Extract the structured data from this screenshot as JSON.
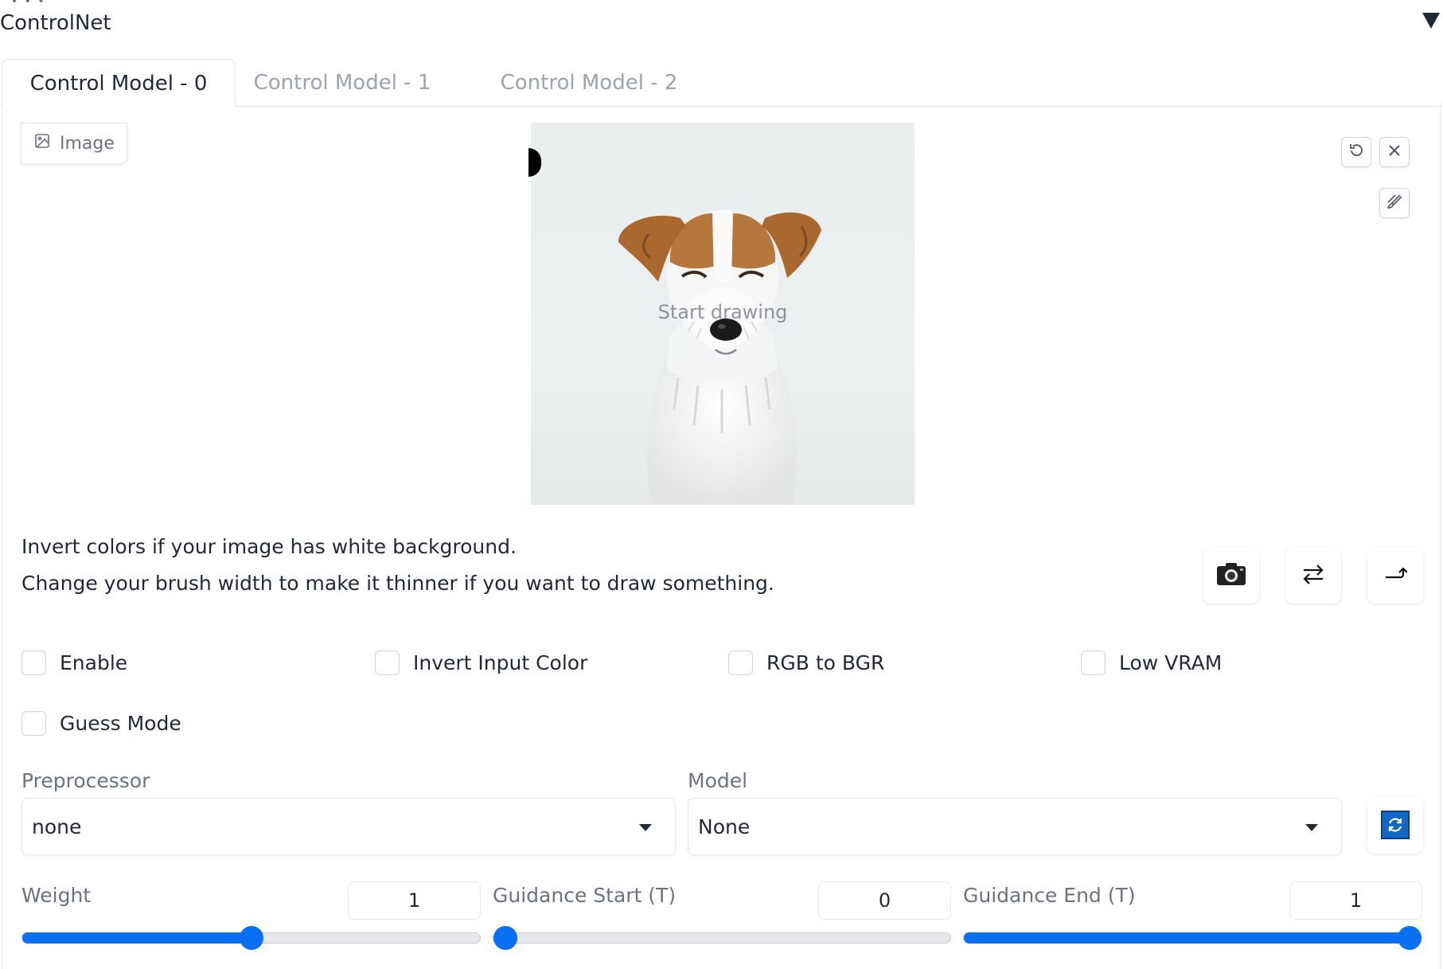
{
  "header": {
    "title": "ControlNet"
  },
  "tabs": [
    {
      "label": "Control Model - 0",
      "active": true
    },
    {
      "label": "Control Model - 1",
      "active": false
    },
    {
      "label": "Control Model - 2",
      "active": false
    }
  ],
  "image_input": {
    "source_label": "Image",
    "canvas_hint": "Start drawing"
  },
  "help_lines": [
    "Invert colors if your image has white background.",
    "Change your brush width to make it thinner if you want to draw something."
  ],
  "checkboxes": [
    {
      "label": "Enable",
      "checked": false
    },
    {
      "label": "Invert Input Color",
      "checked": false
    },
    {
      "label": "RGB to BGR",
      "checked": false
    },
    {
      "label": "Low VRAM",
      "checked": false
    },
    {
      "label": "Guess Mode",
      "checked": false
    }
  ],
  "preprocessor": {
    "label": "Preprocessor",
    "value": "none"
  },
  "model": {
    "label": "Model",
    "value": "None"
  },
  "sliders": [
    {
      "label": "Weight",
      "value": "1",
      "fraction": 0.5
    },
    {
      "label": "Guidance Start (T)",
      "value": "0",
      "fraction": 0.0
    },
    {
      "label": "Guidance End (T)",
      "value": "1",
      "fraction": 1.0
    }
  ],
  "icons": {
    "image_source": "image-icon",
    "undo": "undo-icon",
    "clear": "close-icon",
    "brush": "brush-icon",
    "camera": "camera-icon",
    "swap": "swap-arrows-icon",
    "send": "send-arrow-icon",
    "refresh": "refresh-icon",
    "collapse": "triangle-down-icon"
  },
  "colors": {
    "accent": "#0a6ff0",
    "refresh_button": "#1268c4",
    "border": "#e5e7eb"
  }
}
